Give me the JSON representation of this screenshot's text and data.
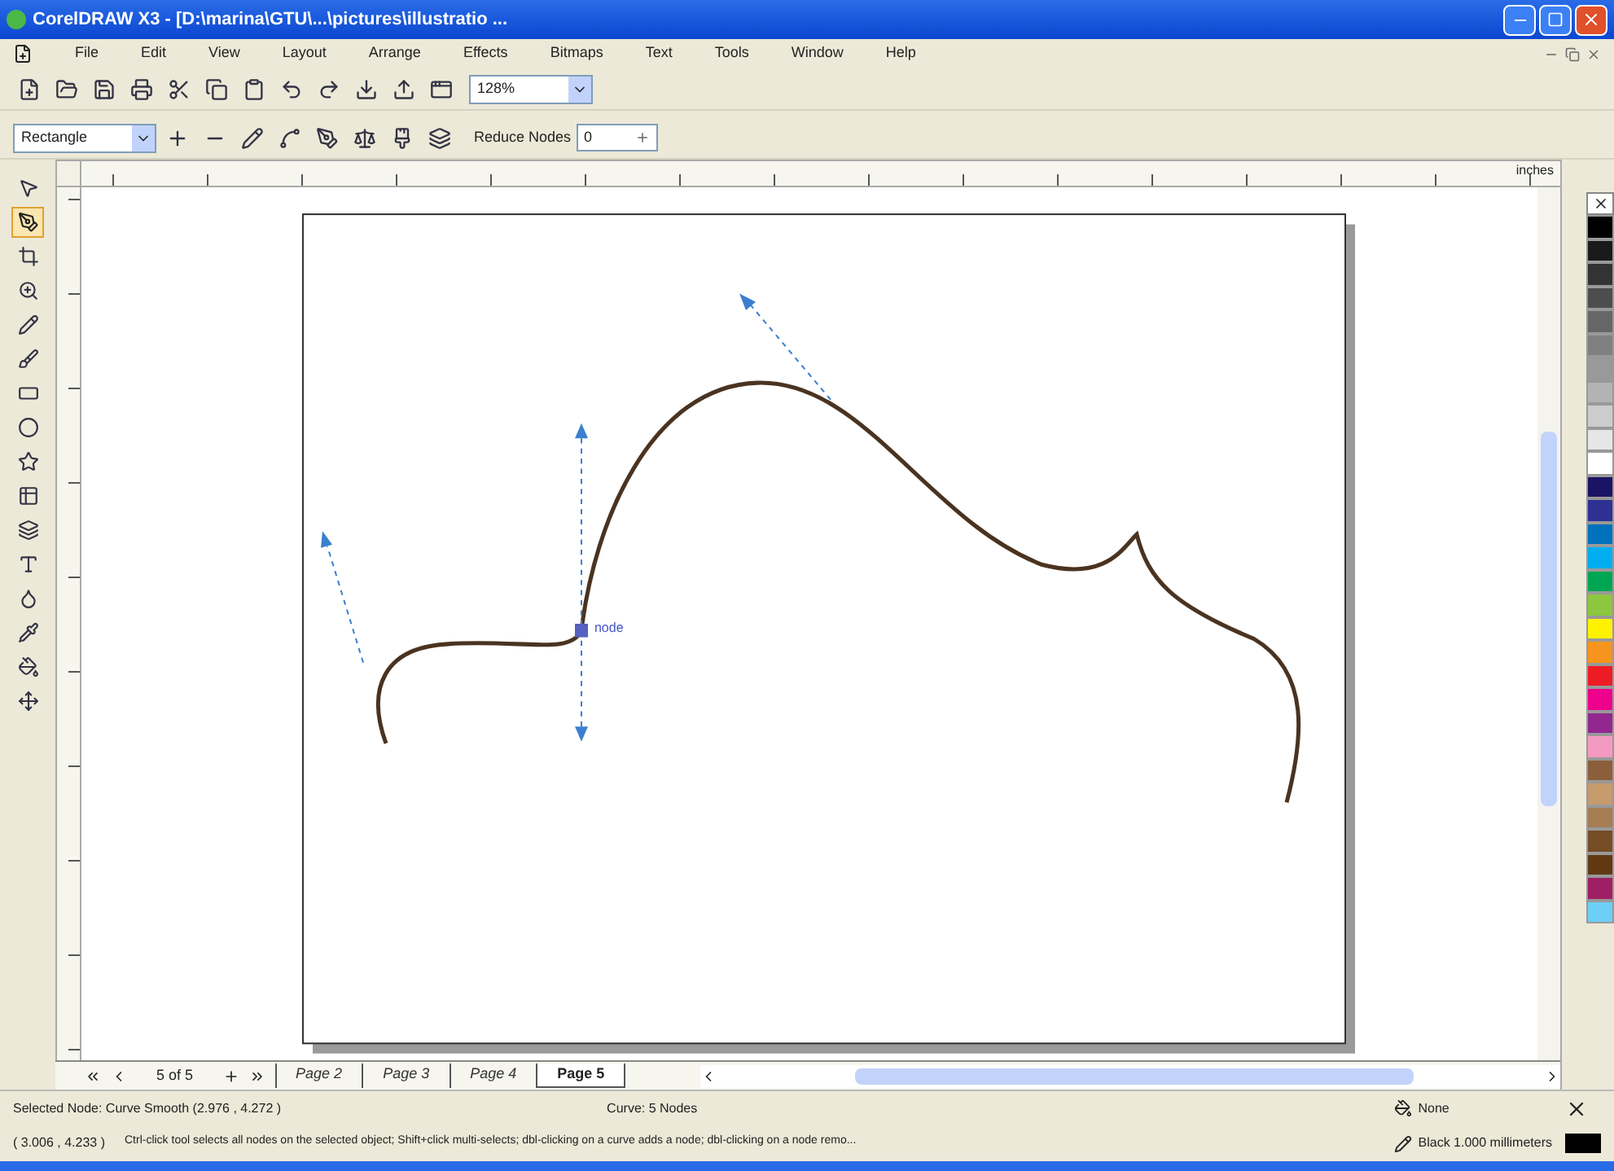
{
  "window": {
    "title": "CorelDRAW X3 - [D:\\marina\\GTU\\...\\pictures\\illustratio ..."
  },
  "menu": [
    "File",
    "Edit",
    "View",
    "Layout",
    "Arrange",
    "Effects",
    "Bitmaps",
    "Text",
    "Tools",
    "Window",
    "Help"
  ],
  "standard_toolbar": {
    "zoom": "128%"
  },
  "property_bar": {
    "shape": "Rectangle",
    "reduce_nodes_label": "Reduce Nodes",
    "reduce_nodes_value": "0"
  },
  "ruler": {
    "unit": "inches"
  },
  "toolbox": [
    {
      "selected": false
    },
    {
      "selected": true
    },
    {
      "selected": false
    },
    {
      "selected": false
    },
    {
      "selected": false
    },
    {
      "selected": false
    },
    {
      "selected": false
    },
    {
      "selected": false
    },
    {
      "selected": false
    },
    {
      "selected": false
    },
    {
      "selected": false
    },
    {
      "selected": false
    },
    {
      "selected": false
    },
    {
      "selected": false
    },
    {
      "selected": false
    },
    {
      "selected": false
    }
  ],
  "canvas": {
    "node_label": "node"
  },
  "page_nav": {
    "position": "5 of 5",
    "tabs": [
      {
        "label": "Page 2",
        "selected": false
      },
      {
        "label": "Page 3",
        "selected": false
      },
      {
        "label": "Page 4",
        "selected": false
      },
      {
        "label": "Page 5",
        "selected": true
      }
    ]
  },
  "palette": [
    {
      "color": "#000000"
    },
    {
      "color": "#1a1a1a"
    },
    {
      "color": "#333333"
    },
    {
      "color": "#4d4d4d"
    },
    {
      "color": "#666666"
    },
    {
      "color": "#808080"
    },
    {
      "color": "#999999"
    },
    {
      "color": "#b3b3b3"
    },
    {
      "color": "#cccccc"
    },
    {
      "color": "#e6e6e6"
    },
    {
      "color": "#ffffff"
    },
    {
      "color": "#1b1464"
    },
    {
      "color": "#2e3192"
    },
    {
      "color": "#0071bc"
    },
    {
      "color": "#00aeef"
    },
    {
      "color": "#00a651"
    },
    {
      "color": "#8dc63f"
    },
    {
      "color": "#fff200"
    },
    {
      "color": "#f7941d"
    },
    {
      "color": "#ed1c24"
    },
    {
      "color": "#ec008c"
    },
    {
      "color": "#92278f"
    },
    {
      "color": "#f49ac1"
    },
    {
      "color": "#8b5e3c"
    },
    {
      "color": "#c69c6d"
    },
    {
      "color": "#a67c52"
    },
    {
      "color": "#754c24"
    },
    {
      "color": "#603913"
    },
    {
      "color": "#9e1f63"
    },
    {
      "color": "#6dcff6"
    }
  ],
  "status_bar": {
    "selection": "Selected Node: Curve Smooth (2.976 , 4.272 )",
    "object": "Curve: 5 Nodes",
    "fill": "None",
    "coordinates": "( 3.006 , 4.233 )",
    "hint": "Ctrl-click tool selects all nodes on the selected object; Shift+click multi-selects; dbl-clicking on a curve adds a node; dbl-clicking on a node remo...",
    "outline": "Black 1.000 millimeters"
  }
}
